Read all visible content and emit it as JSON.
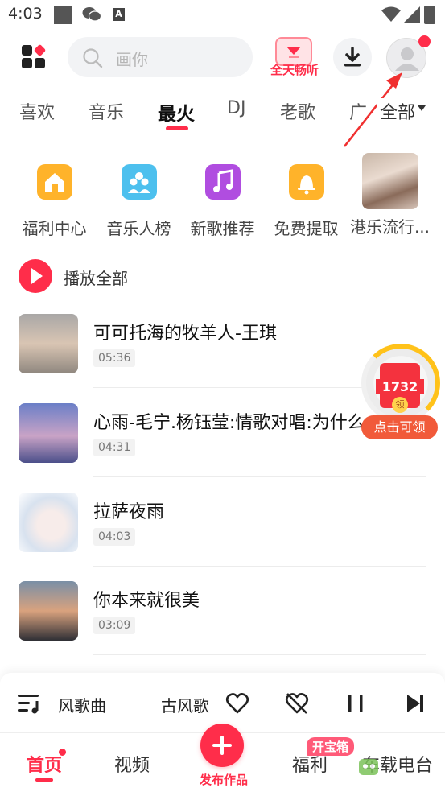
{
  "status_bar": {
    "time": "4:03",
    "a_badge": "A"
  },
  "header": {
    "search_placeholder": "画你",
    "allday_label": "全天畅听"
  },
  "tabs": {
    "items": [
      "喜欢",
      "音乐",
      "最火",
      "DJ",
      "老歌",
      "广"
    ],
    "active": "最火",
    "all_label": "全部"
  },
  "shortcuts": [
    {
      "label": "福利中心",
      "color": "#ffb32a"
    },
    {
      "label": "音乐人榜",
      "color": "#4dc0ee"
    },
    {
      "label": "新歌推荐",
      "color": "#b04de0"
    },
    {
      "label": "免费提取",
      "color": "#ffb32a"
    },
    {
      "label": "港乐流行..."
    }
  ],
  "play_all_label": "播放全部",
  "songs": [
    {
      "title": "可可托海的牧羊人-王琪",
      "duration": "05:36"
    },
    {
      "title": "心雨-毛宁.杨钰莹:情歌对唱:为什么",
      "duration": "04:31"
    },
    {
      "title": "拉萨夜雨",
      "duration": "04:03"
    },
    {
      "title": "你本来就很美",
      "duration": "03:09"
    }
  ],
  "reward": {
    "count": "1732",
    "coin": "领",
    "button": "点击可领"
  },
  "player": {
    "song": "风歌曲",
    "artist": "古风歌"
  },
  "nav": {
    "home": "首页",
    "video": "视频",
    "publish": "发布作品",
    "welfare": "福利",
    "treasure_badge": "开宝箱",
    "radio": "车载电台"
  },
  "colors": {
    "accent": "#ff2d4a"
  }
}
